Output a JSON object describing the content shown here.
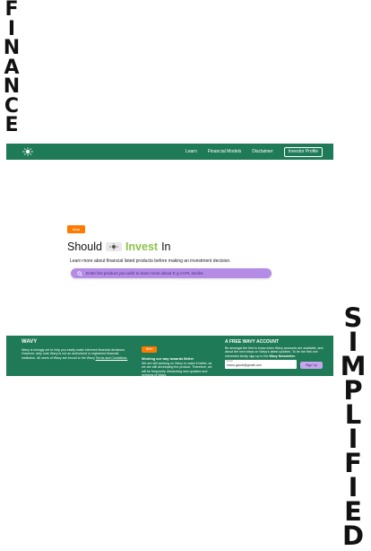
{
  "left_word": [
    "F",
    "I",
    "N",
    "A",
    "N",
    "C",
    "E"
  ],
  "right_word": [
    "S",
    "I",
    "M",
    "P",
    "L",
    "I",
    "F",
    "I",
    "E",
    "D"
  ],
  "nav": {
    "logo_icon": "sun-logo-icon",
    "links": [
      "Learn",
      "Financial Models",
      "Disclaimer"
    ],
    "profile_button": "Investor Profile"
  },
  "hero": {
    "badge": "Beta",
    "headline_prefix": "Should",
    "headline_icon": "sun-logo-icon",
    "headline_highlight": "Invest",
    "headline_suffix": "In",
    "subtext": "Learn more about financial listed products before making an investment decision.",
    "search_placeholder": "Enter the product you wish to learn more about E.g AAPL stocks"
  },
  "footer": {
    "brand": "WAVY",
    "about": "Wavy is lovingly set to help you easily make informed financial decisions. However, duty note Wavy is not an authorised or registered financial institution. All users of Wavy are bound to the Wavy",
    "terms_link": "Terms and Conditions.",
    "badge": "Beta",
    "beta_heading": "Working our way towards Better",
    "beta_text": "We are still working on Wavy to make it better, as we are still developing the product. Therefore, we will be frequently rebranding new updates and versions of Wavy.",
    "account_heading": "A FREE WAVY ACCOUNT",
    "account_text": "Be amongst the first to know when Wavy accounts are available, and about the next steps on Wavy's latest updates. To be the first one interested kindly sign up to the",
    "account_text_bold": "Wavy Newsletter.",
    "email_label": "Email",
    "email_value": "mano.gaoat@gmail.com",
    "signup_button": "Sign Up"
  },
  "colors": {
    "green": "#1f7a57",
    "orange": "#ff7a00",
    "purple": "#b48ce6",
    "invest_green": "#8bc34a"
  }
}
